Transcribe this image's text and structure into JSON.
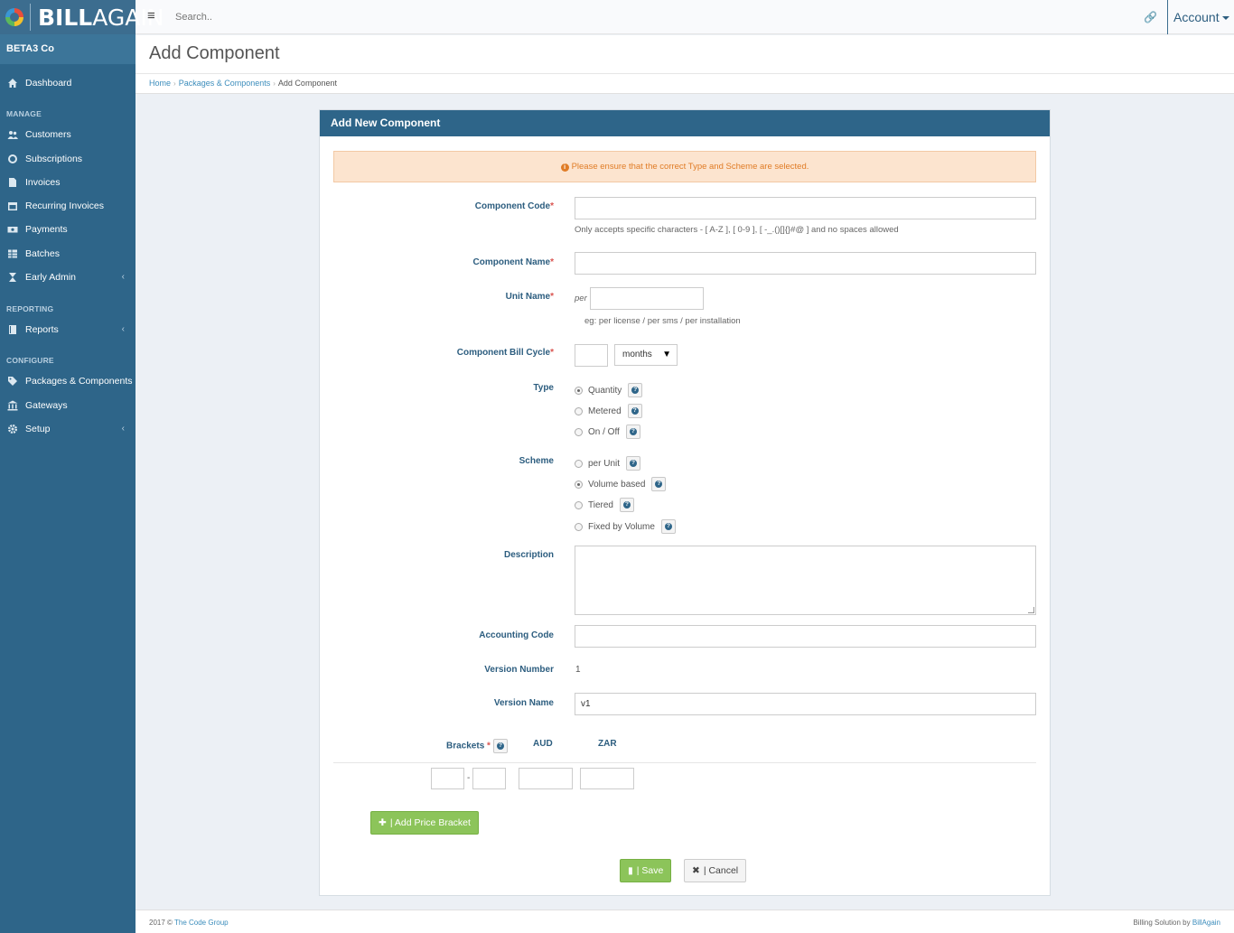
{
  "brand": {
    "name_bold": "BILL",
    "name_light": "AGAIN"
  },
  "topbar": {
    "search_placeholder": "Search..",
    "account_label": "Account"
  },
  "sidebar": {
    "company": "BETA3 Co",
    "dashboard": "Dashboard",
    "sections": {
      "manage": "MANAGE",
      "reporting": "REPORTING",
      "configure": "CONFIGURE"
    },
    "items": {
      "customers": "Customers",
      "subscriptions": "Subscriptions",
      "invoices": "Invoices",
      "recurring_invoices": "Recurring Invoices",
      "payments": "Payments",
      "batches": "Batches",
      "early_admin": "Early Admin",
      "reports": "Reports",
      "packages_components": "Packages & Components",
      "gateways": "Gateways",
      "setup": "Setup"
    }
  },
  "page": {
    "title": "Add Component",
    "breadcrumb": {
      "home": "Home",
      "packages": "Packages & Components",
      "current": "Add Component"
    }
  },
  "form": {
    "panel_title": "Add New Component",
    "alert": "Please ensure that the correct Type and Scheme are selected.",
    "component_code": {
      "label": "Component Code",
      "value": "",
      "help": "Only accepts specific characters - [ A-Z ], [ 0-9 ], [ -_.()[]{}#@ ] and no spaces allowed"
    },
    "component_name": {
      "label": "Component Name",
      "value": ""
    },
    "unit_name": {
      "label": "Unit Name",
      "prefix": "per",
      "value": "",
      "help": "eg: per license / per sms / per installation"
    },
    "bill_cycle": {
      "label": "Component Bill Cycle",
      "value": "",
      "unit": "months"
    },
    "type": {
      "label": "Type",
      "options": [
        "Quantity",
        "Metered",
        "On / Off"
      ],
      "selected": "Quantity"
    },
    "scheme": {
      "label": "Scheme",
      "options": [
        "per Unit",
        "Volume based",
        "Tiered",
        "Fixed by Volume"
      ],
      "selected": "Volume based"
    },
    "description": {
      "label": "Description",
      "value": ""
    },
    "accounting_code": {
      "label": "Accounting Code",
      "value": ""
    },
    "version_number": {
      "label": "Version Number",
      "value": "1"
    },
    "version_name": {
      "label": "Version Name",
      "value": "v1"
    },
    "brackets": {
      "label": "Brackets",
      "currencies": [
        "AUD",
        "ZAR"
      ],
      "range_separator": "-"
    },
    "add_bracket_label": "| Add Price Bracket",
    "save_label": "| Save",
    "cancel_label": "| Cancel"
  },
  "footer": {
    "copyright": "2017 ©",
    "company_link": "The Code Group",
    "right_text": "Billing Solution by",
    "right_link": "BillAgain"
  },
  "colors": {
    "sidebar": "#2e6589",
    "accent": "#3c8dbc",
    "green": "#8cc45a",
    "alert_bg": "#fce4cf",
    "alert_text": "#e07c26",
    "required": "#d9534f"
  }
}
